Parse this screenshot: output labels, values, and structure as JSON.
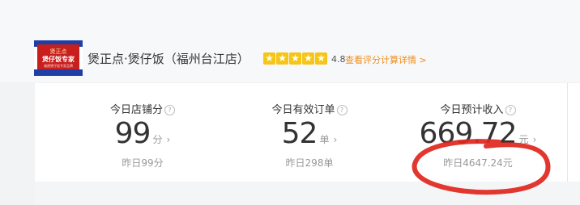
{
  "shop": {
    "logo": {
      "line1": "煲正点",
      "line2": "煲仔饭专家",
      "line3": "福建煲仔饭专家品牌"
    },
    "name": "煲正点·煲仔饭（福州台江店）",
    "stars": [
      "★",
      "★",
      "★",
      "★",
      "★"
    ],
    "rating": "4.8",
    "detail_link": "查看评分计算详情 >"
  },
  "metrics": [
    {
      "label": "今日店铺分",
      "value": "99",
      "unit": "分",
      "arrow": "›",
      "yesterday": "昨日99分"
    },
    {
      "label": "今日有效订单",
      "value": "52",
      "unit": "单",
      "arrow": "›",
      "yesterday": "昨日298单"
    },
    {
      "label": "今日预计收入",
      "value": "669.72",
      "unit": "元",
      "arrow": "›",
      "yesterday": "昨日4647.24元"
    }
  ],
  "help_icon": "?",
  "colors": {
    "accent": "#f08c1a",
    "star": "#f5c518",
    "annotation": "#e0261c"
  }
}
